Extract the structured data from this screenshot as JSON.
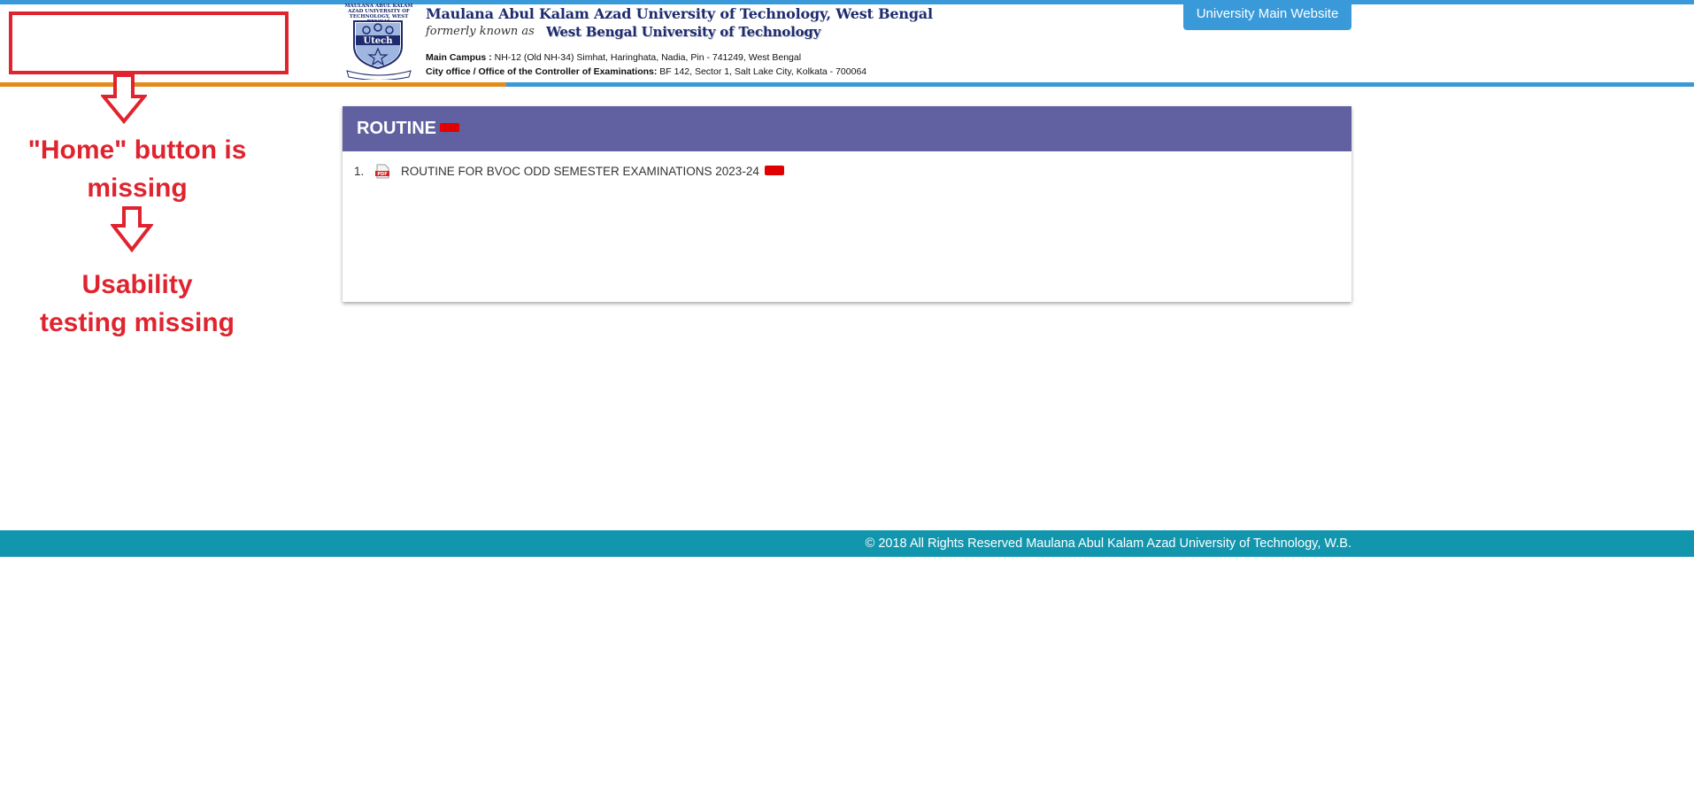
{
  "header": {
    "logo_top_text": "MAULANA ABUL KALAM AZAD UNIVERSITY OF TECHNOLOGY, WEST BENGAL",
    "logo_word": "Utech",
    "university_name": "Maulana Abul Kalam Azad University of Technology, West Bengal",
    "formerly_label": "formerly known as",
    "former_name": "West Bengal University of Technology",
    "main_campus_label": "Main Campus :",
    "main_campus_value": " NH-12 (Old NH-34) Simhat, Haringhata, Nadia, Pin - 741249, West Bengal",
    "city_office_label": "City office / Office of the Controller of Examinations:",
    "city_office_value": " BF 142, Sector 1, Salt Lake City, Kolkata - 700064",
    "main_site_button": "University Main Website"
  },
  "annotations": {
    "line1a": "\"Home\" button is",
    "line1b": "missing",
    "line2a": "Usability",
    "line2b": "testing missing",
    "color": "#e0242f"
  },
  "panel": {
    "title": "ROUTINE",
    "items": [
      {
        "number": "1.",
        "icon": "pdf-icon",
        "label": "ROUTINE FOR BVOC ODD SEMESTER EXAMINATIONS 2023-24"
      }
    ]
  },
  "footer": {
    "text": "© 2018 All Rights Reserved Maulana Abul Kalam Azad University of Technology, W.B."
  },
  "colors": {
    "top_bar": "#3a9ad9",
    "header_line_left": "#e48a1c",
    "panel_header": "#6160a0",
    "footer": "#1296ae",
    "new_badge": "#e00000"
  }
}
